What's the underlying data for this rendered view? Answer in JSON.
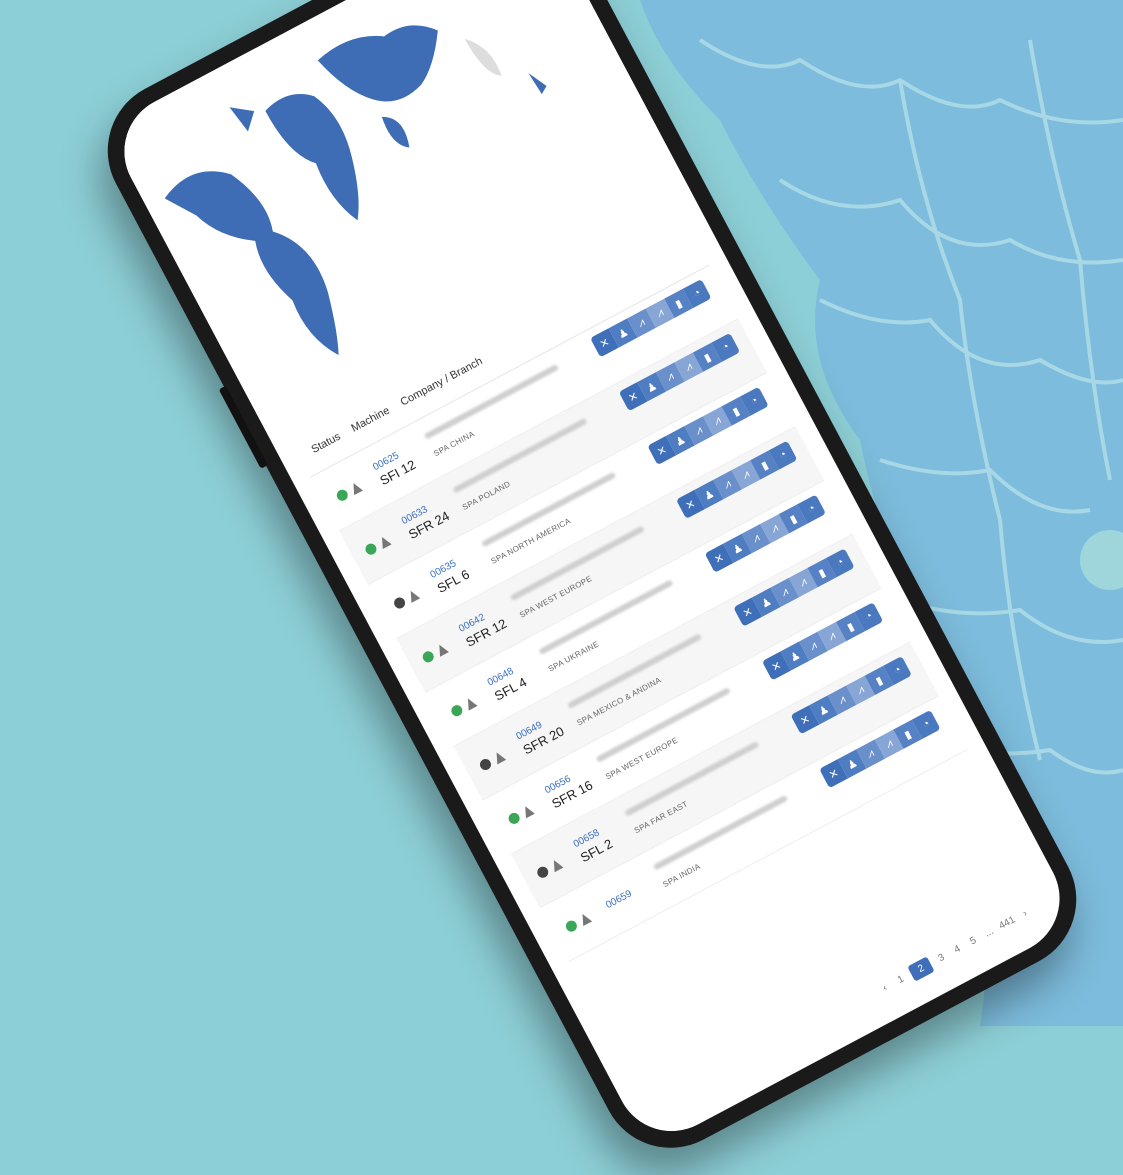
{
  "table": {
    "headers": {
      "status": "Status",
      "machine": "Machine",
      "company": "Company / Branch"
    },
    "rows": [
      {
        "id": "00625",
        "machine": "SFI 12",
        "branch": "SPA CHINA",
        "status": "ok"
      },
      {
        "id": "00633",
        "machine": "SFR 24",
        "branch": "SPA POLAND",
        "status": "ok"
      },
      {
        "id": "00635",
        "machine": "SFL 6",
        "branch": "SPA NORTH AMERICA",
        "status": "off"
      },
      {
        "id": "00642",
        "machine": "SFR 12",
        "branch": "SPA WEST EUROPE",
        "status": "ok"
      },
      {
        "id": "00648",
        "machine": "SFL 4",
        "branch": "SPA UKRAINE",
        "status": "ok"
      },
      {
        "id": "00649",
        "machine": "SFR 20",
        "branch": "SPA MEXICO & ANDINA",
        "status": "off"
      },
      {
        "id": "00656",
        "machine": "SFR 16",
        "branch": "SPA WEST EUROPE",
        "status": "ok"
      },
      {
        "id": "00658",
        "machine": "SFL 2",
        "branch": "SPA FAR EAST",
        "status": "off"
      },
      {
        "id": "00659",
        "machine": "",
        "branch": "SPA INDIA",
        "status": "ok"
      }
    ],
    "action_icons": [
      "wrench-icon",
      "person-icon",
      "chart-icon",
      "chart-icon",
      "phone-icon",
      "gauge-icon"
    ]
  },
  "pagination": {
    "prev": "‹",
    "pages": [
      "1",
      "2",
      "3",
      "4",
      "5",
      "...",
      "441"
    ],
    "next": "›",
    "active": "2"
  },
  "colors": {
    "accent": "#3f6fb8",
    "background": "#8dcfd6",
    "map_fill": "#3e6db6"
  }
}
